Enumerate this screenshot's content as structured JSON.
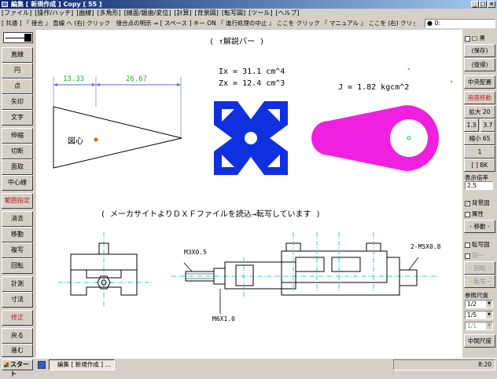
{
  "window": {
    "title": "編集 [ 新規作成 ] Copy [ 55 ]"
  },
  "menu": [
    "[ファイル]",
    "[操作/ハッチ]",
    "[曲線]",
    "[多角形]",
    "[線面/鋸歯/変位]",
    "[計算]",
    "[背景図]",
    "[転写図]",
    "[ツール]",
    "[ヘルプ]"
  ],
  "guide": "[ 共通 ] 『 接合 』 直線 へ (右) クリック　接合点の明示 ⇒ [ スペース ] キー ON 『 進行処理の中止 』 ここを クリック 『 マニュアル 』 ここを (右) クリック",
  "layer": "● 0:",
  "left_buttons": [
    "直線",
    "円",
    "点",
    "矢印",
    "文字",
    "伸縮",
    "切断",
    "面取",
    "中心線",
    "範囲指定",
    "消去",
    "移動",
    "複写",
    "回転",
    "計測",
    "寸法",
    "修正",
    "戻る",
    "進む"
  ],
  "right": {
    "kuro_label": "黒",
    "hozon": "(保存)",
    "fukki": "(復帰)",
    "chuo": "中央配置",
    "gamen": "画面移動",
    "kakudai": "拡大 20",
    "z13": "1.3",
    "z37": "3.7",
    "shukusho": "縮小 65",
    "one": "1",
    "bk": "[ ] BK",
    "hyoji_label": "表示倍率",
    "hyoji_value": "2.5",
    "haikei": "背景図",
    "zokusei": "属性",
    "idou1": "- 移動 -",
    "tensha": "転写図",
    "dou": "同一",
    "kaiten": "- 回転 -",
    "tensha2": "- 転写 -",
    "sanshou_label": "参照尺度",
    "scale1": "1/2",
    "scale2": "1/5",
    "scale3": "1/1",
    "chukan": "中間尺度"
  },
  "canvas": {
    "hint1": "( ↑解説バー )",
    "dim1": "13.33",
    "dim2": "26.67",
    "zushin": "図心",
    "ix": "Ix = 31.1 cm^4",
    "zx": "Zx = 12.4 cm^3",
    "j": "J = 1.82 kgcm^2",
    "hint2": "( メーカサイトよりＤＸＦファイルを読込→転写しています )",
    "m3": "M3X0.5",
    "m6": "M6X1.0",
    "m5": "2-M5X0.8"
  },
  "taskbar": {
    "start": "スタート",
    "item": "編集 [ 新規作成 ] ...",
    "clock": "8:20"
  }
}
